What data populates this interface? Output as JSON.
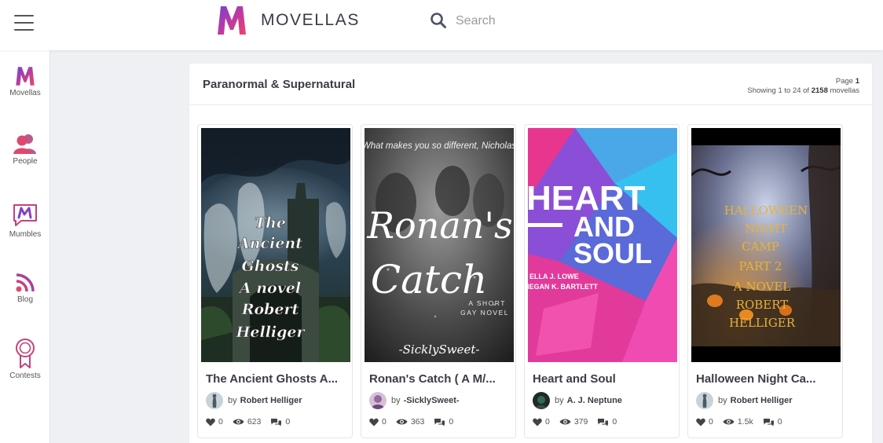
{
  "header": {
    "brand": "MOVELLAS",
    "search_placeholder": "Search"
  },
  "sidebar": {
    "items": [
      {
        "label": "Movellas",
        "icon": "movellas-logo-icon"
      },
      {
        "label": "People",
        "icon": "people-icon"
      },
      {
        "label": "Mumbles",
        "icon": "mumbles-icon"
      },
      {
        "label": "Blog",
        "icon": "rss-icon"
      },
      {
        "label": "Contests",
        "icon": "ribbon-icon"
      }
    ]
  },
  "listing": {
    "title": "Paranormal & Supernatural",
    "page_label": "Page",
    "page_number": "1",
    "showing_prefix": "Showing 1 to 24 of",
    "total": "2158",
    "showing_suffix": "movellas"
  },
  "books": [
    {
      "title": "The Ancient Ghosts A...",
      "by": "by",
      "author": "Robert Helliger",
      "likes": "0",
      "views": "623",
      "comments": "0",
      "cover_lines": [
        "The",
        "Ancient",
        "Ghosts",
        "A novel",
        "Robert",
        "Helliger"
      ]
    },
    {
      "title": "Ronan's Catch ( A M/...",
      "by": "by",
      "author": "-SicklySweet-",
      "likes": "0",
      "views": "363",
      "comments": "0",
      "cover_top": "What makes you so different, Nicholas",
      "cover_script": [
        "Ronan's",
        "Catch"
      ],
      "cover_sub": [
        "A SHORT",
        "GAY NOVEL"
      ],
      "cover_author": "-SicklySweet-"
    },
    {
      "title": "Heart and Soul",
      "by": "by",
      "author": "A. J. Neptune",
      "likes": "0",
      "views": "379",
      "comments": "0",
      "cover_lines": [
        "HEART",
        "AND",
        "SOUL"
      ],
      "cover_authors": [
        "ELLA J. LOWE",
        "MEGAN K. BARTLETT"
      ]
    },
    {
      "title": "Halloween Night Ca...",
      "by": "by",
      "author": "Robert Helliger",
      "likes": "0",
      "views": "1.5k",
      "comments": "0",
      "cover_lines": [
        "HALLOWEEN",
        "NIGHT",
        "CAMP",
        "PART 2",
        "A NOVEL",
        "ROBERT",
        "HELLIGER"
      ]
    }
  ],
  "colors": {
    "brand_pink": "#e0347a",
    "brand_purple": "#8a3fc0",
    "text_dark": "#3c3c46"
  }
}
